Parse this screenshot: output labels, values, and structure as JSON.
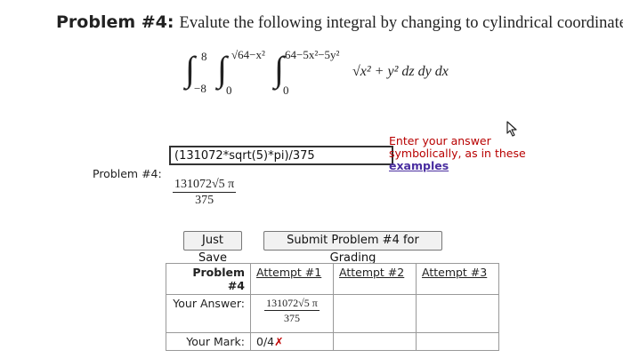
{
  "header": {
    "title_bold": "Problem #4:",
    "title_text": "Evalute the following integral by changing to cylindrical coordinates."
  },
  "formula": {
    "int1_upper": "8",
    "int1_lower": "−8",
    "int2_upper": "√64−x²",
    "int2_lower": "0",
    "int3_upper": "64−5x²−5y²",
    "int3_lower": "0",
    "integrand": "√x² + y² dz dy dx"
  },
  "answer": {
    "value": "(131072*sqrt(5)*pi)/375",
    "hint_line1": "Enter your answer",
    "hint_line2": "symbolically, as in these",
    "hint_link": "examples",
    "problem_label": "Problem #4:",
    "preview_numerator": "131072√5 π",
    "preview_denominator": "375"
  },
  "buttons": {
    "save": "Just Save",
    "submit": "Submit Problem #4 for Grading"
  },
  "status_table": {
    "header_label": "Problem #4",
    "attempts": [
      "Attempt #1",
      "Attempt #2",
      "Attempt #3"
    ],
    "answer_label": "Your Answer:",
    "answer_numerator": "131072√5 π",
    "answer_denominator": "375",
    "mark_label": "Your Mark:",
    "mark_value": "0/4",
    "mark_symbol": "✗"
  },
  "colors": {
    "hint": "#b80000",
    "link": "#4a2ea0",
    "mark_wrong": "#c00000"
  }
}
